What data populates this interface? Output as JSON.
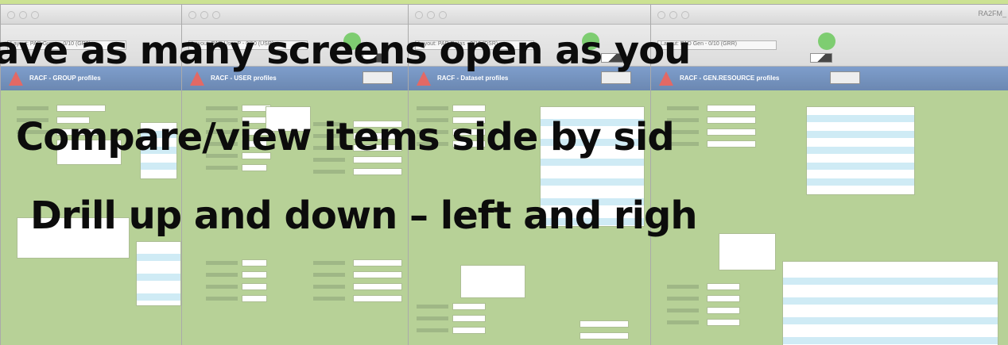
{
  "slide": {
    "line1": "ave as many screens open as you",
    "line2": "Compare/view items side by sid",
    "line3": "Drill up and down – left and righ"
  },
  "windows": [
    {
      "header": "RACF - GROUP profiles",
      "layout": "Layout:  PAD Group - 0/10 (GR0)"
    },
    {
      "header": "RACF - USER profiles",
      "layout": "Layout:  PAD User P - 0/10 (USR)"
    },
    {
      "header": "RACF - Dataset profiles",
      "layout": "Layout:  PAD Datas - 0/10 (DSR)"
    },
    {
      "header": "RACF - GEN.RESOURCE profiles",
      "layout": "Layout:  PAD Gen - 0/10 (GRR)",
      "title": "RA2FM_"
    }
  ],
  "colors": {
    "window_bg": "#9bbf6f",
    "header_blue": "#3d679f",
    "stripe": "#bde3f2"
  }
}
